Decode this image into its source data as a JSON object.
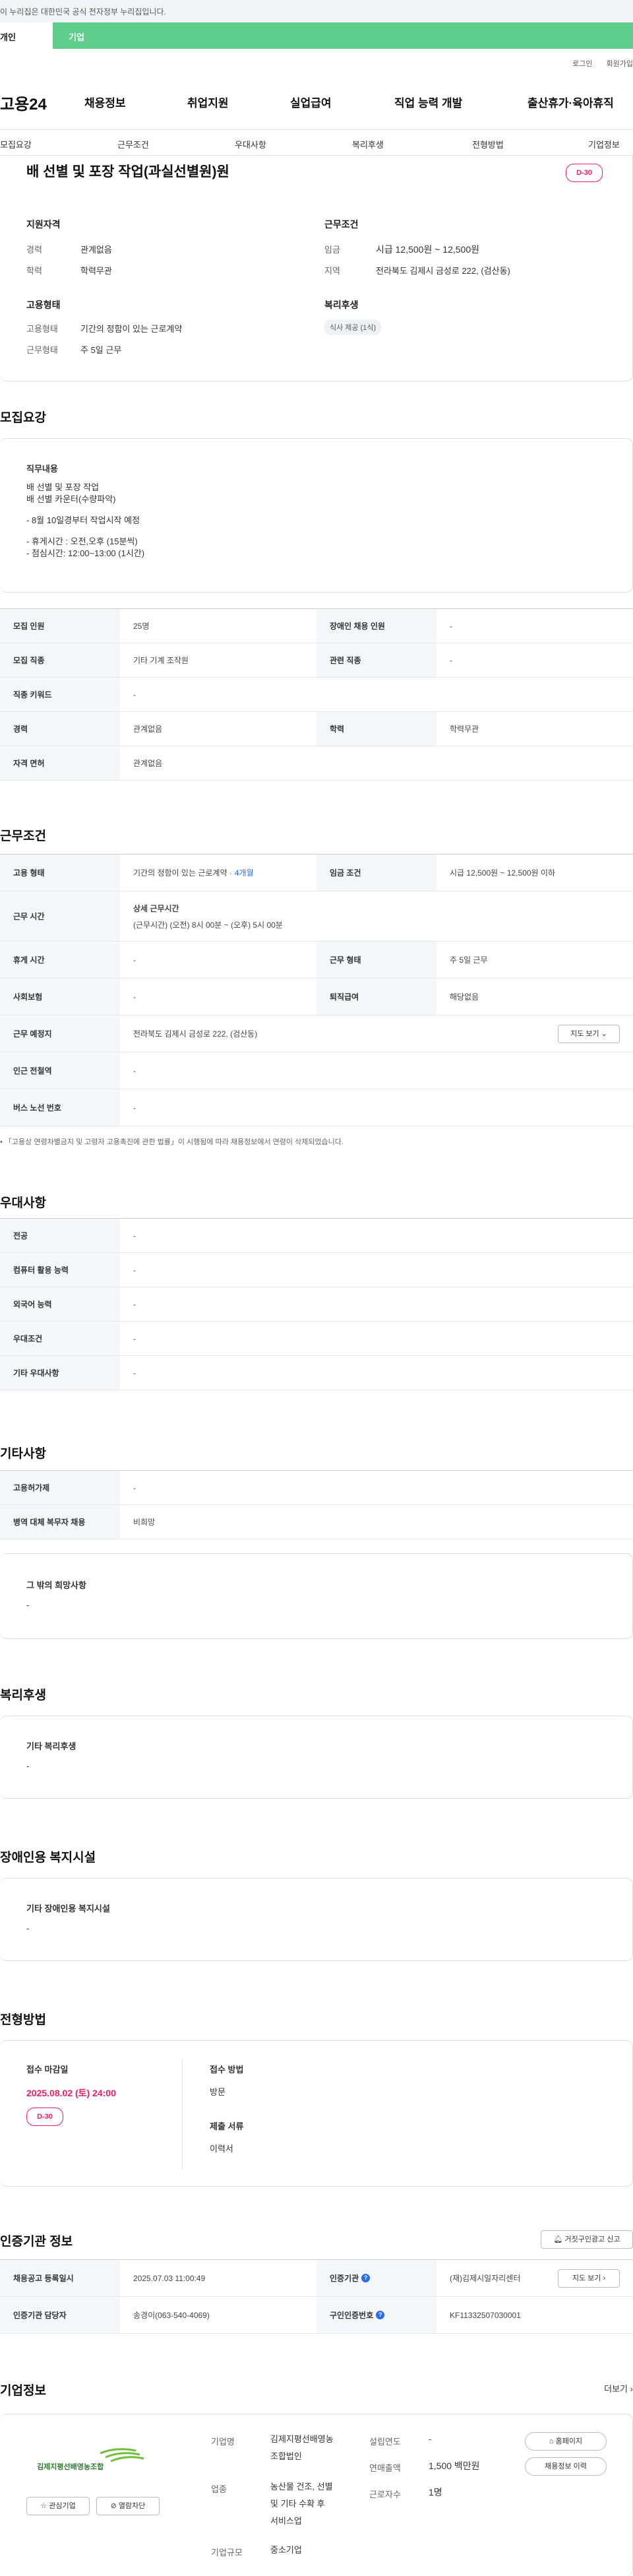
{
  "gov_banner": "이 누리집은 대한민국 공식 전자정부 누리집입니다.",
  "top_tabs": {
    "personal": "개인",
    "company": "기업"
  },
  "util_links": [
    "로그인",
    "회원가입"
  ],
  "logo": "고용24",
  "gnb": [
    "채용정보",
    "취업지원",
    "실업급여",
    "직업 능력 개발",
    "출산휴가·육아휴직"
  ],
  "anchor_nav": [
    "모집요강",
    "근무조건",
    "우대사항",
    "복리후생",
    "전형방법",
    "기업정보"
  ],
  "job": {
    "title": "배 선별 및 포장 작업(과실선별원)원",
    "dday": "D-30",
    "summary": {
      "qual_title": "지원자격",
      "career_label": "경력",
      "career_value": "관계없음",
      "edu_label": "학력",
      "edu_value": "학력무관",
      "cond_title": "근무조건",
      "wage_label": "임금",
      "wage_value": "시급 12,500원 ~ 12,500원",
      "area_label": "지역",
      "area_value": "전라북도 김제시 금성로 222, (검산동)",
      "emp_title": "고용형태",
      "emp_label": "고용형태",
      "emp_value": "기간의 정함이 있는 근로계약",
      "work_label": "근무형태",
      "work_value": "주 5일 근무",
      "welfare_title": "복리후생",
      "welfare_chip": "식사 제공 (1식)"
    }
  },
  "recruit": {
    "title": "모집요강",
    "content_head": "직무내용",
    "content_lines": [
      "배 선별 및 포장 작업",
      "배 선별 카운터(수량파악)",
      "",
      "- 8월 10일경부터 작업시작 예정",
      "",
      "- 휴게시간 : 오전,오후 (15분씩)",
      "- 점심시간: 12:00~13:00 (1시간)"
    ],
    "rows": [
      {
        "k1": "모집 인원",
        "v1": "25명",
        "k2": "장애인 채용 인원",
        "v2": "-"
      },
      {
        "k1": "모집 직종",
        "v1": "기타 기계 조작원",
        "k2": "관련 직종",
        "v2": "-"
      },
      {
        "k1": "직종 키워드",
        "v1": "-"
      },
      {
        "k1": "경력",
        "v1": "관계없음",
        "k2": "학력",
        "v2": "학력무관"
      },
      {
        "k1": "자격 면허",
        "v1": "관계없음"
      }
    ]
  },
  "conditions": {
    "title": "근무조건",
    "emp_type_label": "고용 형태",
    "emp_type_value": "기간의 정함이 있는 근로계약 · ",
    "emp_type_period": "4개월",
    "wage_label": "임금 조건",
    "wage_value": "시급 12,500원 ~ 12,500원 이하",
    "hours_label": "근무 시간",
    "hours_head": "상세 근무시간",
    "hours_value": "(근무시간) (오전) 8시 00분 ~ (오후) 5시 00분",
    "break_label": "휴게 시간",
    "break_value": "-",
    "form_label": "근무 형태",
    "form_value": "주 5일 근무",
    "insurance_label": "사회보험",
    "insurance_value": "-",
    "severance_label": "퇴직급여",
    "severance_value": "해당없음",
    "place_label": "근무 예정지",
    "place_value": "전라북도 김제시 금성로 222, (검산동)",
    "map_btn": "지도 보기",
    "station_label": "인근 전철역",
    "station_value": "-",
    "bus_label": "버스 노선 번호",
    "bus_value": "-",
    "note": "• 「고용상 연령차별금지 및 고령자 고용촉진에 관한 법률」이 시행됨에 따라 채용정보에서 연령이 삭제되었습니다."
  },
  "preference": {
    "title": "우대사항",
    "rows": [
      {
        "k": "전공",
        "v": "-"
      },
      {
        "k": "컴퓨터 활용 능력",
        "v": "-"
      },
      {
        "k": "외국어 능력",
        "v": "-"
      },
      {
        "k": "우대조건",
        "v": "-"
      },
      {
        "k": "기타 우대사항",
        "v": "-"
      }
    ]
  },
  "other": {
    "title": "기타사항",
    "rows": [
      {
        "k": "고용허가제",
        "v": "-"
      },
      {
        "k": "병역 대체 복무자 채용",
        "v": "비희망"
      }
    ],
    "wish_head": "그 밖의 희망사항",
    "wish_value": "-"
  },
  "welfare": {
    "title": "복리후생",
    "head": "기타 복리후생",
    "value": "-"
  },
  "disability": {
    "title": "장애인용 복지시설",
    "head": "기타 장애인용 복지시설",
    "value": "-"
  },
  "selection": {
    "title": "전형방법",
    "deadline_head": "접수 마감일",
    "deadline_value": "2025.08.02 (토) 24:00",
    "dday": "D-30",
    "method_head": "접수 방법",
    "method_value": "방문",
    "docs_head": "제출 서류",
    "docs_value": "이력서"
  },
  "agency": {
    "title": "인증기관 정보",
    "report_btn": "거짓구인광고 신고",
    "reg_label": "채용공고 등록일시",
    "reg_value": "2025.07.03 11:00:49",
    "org_label": "인증기관",
    "org_value": "(재)김제시일자리센터",
    "map_btn": "지도 보기",
    "manager_label": "인증기관 담당자",
    "manager_value": "송경이(063-540-4069)",
    "number_label": "구인인증번호",
    "number_value": "KF11332507030001"
  },
  "company": {
    "title": "기업정보",
    "more": "더보기",
    "logo_text": "김제지평선배영농조합",
    "fav_btn": "관심기업",
    "block_btn": "열람차단",
    "name_label": "기업명",
    "name_value": "김제지평선배영농\n조합법인",
    "industry_label": "업종",
    "industry_value": "농산물 건조, 선별\n및 기타 수확 후\n서비스업",
    "size_label": "기업규모",
    "size_value": "중소기업",
    "year_label": "설립연도",
    "year_value": "-",
    "sales_label": "연매출액",
    "sales_value": "1,500 백만원",
    "staff_label": "근로자수",
    "staff_value": "1명",
    "home_btn": "홈페이지",
    "jobs_btn": "채용정보 이력"
  },
  "colors": {
    "accent_green": "#5fcd8c",
    "dday_pink": "#e91e63",
    "link_blue": "#2a6bf2"
  }
}
